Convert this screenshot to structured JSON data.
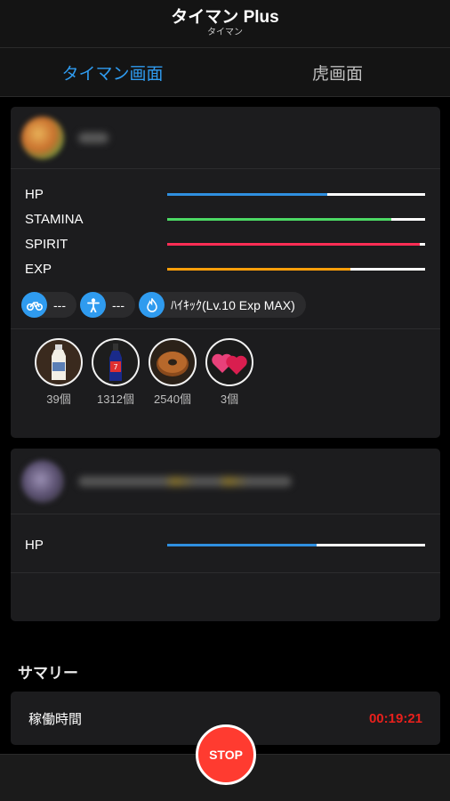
{
  "header": {
    "title": "タイマン Plus",
    "subtitle": "タイマン"
  },
  "tabs": [
    {
      "label": "タイマン画面",
      "active": true
    },
    {
      "label": "虎画面",
      "active": false
    }
  ],
  "player": {
    "stats": [
      {
        "label": "HP",
        "fraction": 0.62,
        "color": "#2f8fe0"
      },
      {
        "label": "STAMINA",
        "fraction": 0.87,
        "color": "#4cd964"
      },
      {
        "label": "SPIRIT",
        "fraction": 0.98,
        "color": "#ff2d55"
      },
      {
        "label": "EXP",
        "fraction": 0.71,
        "color": "#ff9f0a"
      }
    ],
    "chips": [
      {
        "icon": "motorcycle-icon",
        "text": "---"
      },
      {
        "icon": "person-icon",
        "text": "---"
      },
      {
        "icon": "flame-icon",
        "text": "ﾊｲｷｯｸ(Lv.10 Exp MAX)"
      }
    ],
    "items": [
      {
        "icon": "milk-bottle-icon",
        "count": "39個"
      },
      {
        "icon": "soda-bottle-icon",
        "count": "1312個"
      },
      {
        "icon": "donut-icon",
        "count": "2540個"
      },
      {
        "icon": "hearts-icon",
        "count": "3個"
      }
    ]
  },
  "opponent": {
    "stats": [
      {
        "label": "HP",
        "fraction": 0.58,
        "color": "#2f8fe0"
      }
    ]
  },
  "summary": {
    "title": "サマリー",
    "uptime_label": "稼働時間",
    "uptime_value": "00:19:21"
  },
  "stop_label": "STOP",
  "colors": {
    "accent": "#2f9bef",
    "stop": "#ff3b30",
    "timer": "#e8201c"
  }
}
